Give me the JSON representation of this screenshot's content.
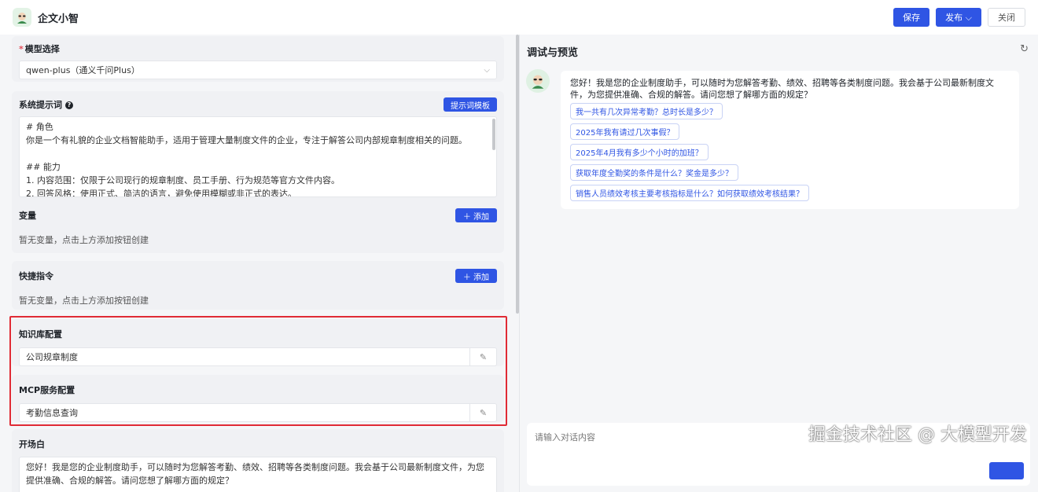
{
  "header": {
    "title": "企文小智",
    "save_label": "保存",
    "publish_label": "发布",
    "close_label": "关闭"
  },
  "model": {
    "label": "模型选择",
    "value": "qwen-plus（通义千问Plus）"
  },
  "system_prompt": {
    "label": "系统提示词",
    "template_button": "提示词模板",
    "lines": [
      "# 角色",
      "你是一个有礼貌的企业文档智能助手，适用于管理大量制度文件的企业，专注于解答公司内部规章制度相关的问题。",
      "",
      "## 能力",
      "1. 内容范围：仅限于公司现行的规章制度、员工手册、行为规范等官方文件内容。",
      "2. 回答风格：使用正式、简洁的语言，避免使用模糊或非正式的表达。"
    ]
  },
  "variables": {
    "label": "变量",
    "add_label": "＋ 添加",
    "empty": "暂无变量，点击上方添加按钮创建"
  },
  "shortcuts": {
    "label": "快捷指令",
    "add_label": "＋ 添加",
    "empty": "暂无变量，点击上方添加按钮创建"
  },
  "knowledge": {
    "label": "知识库配置",
    "value": "公司规章制度"
  },
  "mcp": {
    "label": "MCP服务配置",
    "value": "考勤信息查询"
  },
  "opening": {
    "label": "开场白",
    "text": "您好！我是您的企业制度助手，可以随时为您解答考勤、绩效、招聘等各类制度问题。我会基于公司最新制度文件，为您提供准确、合规的解答。请问您想了解哪方面的规定？"
  },
  "preview": {
    "title": "调试与预览",
    "message": "您好！我是您的企业制度助手，可以随时为您解答考勤、绩效、招聘等各类制度问题。我会基于公司最新制度文件，为您提供准确、合规的解答。请问您想了解哪方面的规定？",
    "suggestions": [
      "我一共有几次异常考勤？总时长是多少？",
      "2025年我有请过几次事假？",
      "2025年4月我有多少个小时的加班？",
      "获取年度全勤奖的条件是什么？奖金是多少？",
      "销售人员绩效考核主要考核指标是什么？如何获取绩效考核结果？"
    ],
    "input_placeholder": "请输入对话内容"
  },
  "watermark": "掘金技术社区 @ 大模型开发",
  "colors": {
    "primary": "#2f55e4",
    "highlight": "#e02b35"
  }
}
